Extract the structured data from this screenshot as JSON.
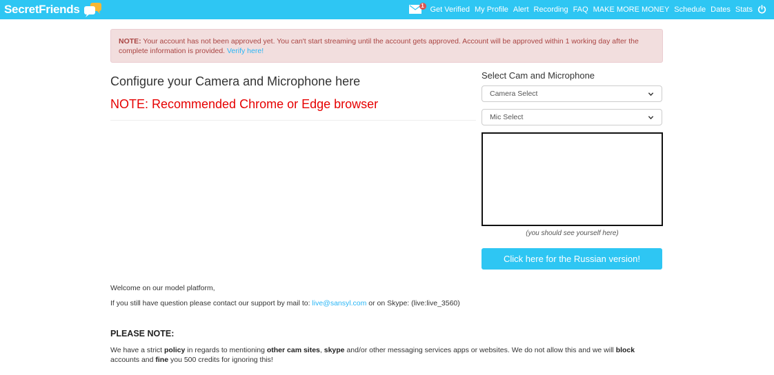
{
  "navbar": {
    "brand": "SecretFriends",
    "mail_count": "1",
    "items": [
      "Get Verified",
      "My Profile",
      "Alert",
      "Recording",
      "FAQ",
      "MAKE MORE MONEY",
      "Schedule",
      "Dates",
      "Stats"
    ],
    "colors": {
      "bar": "#2ec6f3",
      "badge": "#d9534f"
    }
  },
  "alert": {
    "label": "NOTE:",
    "text": " Your account has not been approved yet. You can't start streaming until the account gets approved. Account will be approved within 1 working day after the complete information is provided. ",
    "link": "Verify here!"
  },
  "main": {
    "title": "Configure your Camera and Microphone here",
    "browser_note": "NOTE: Recommended Chrome or Edge browser"
  },
  "device": {
    "heading": "Select Cam and Microphone",
    "camera_select": "Camera Select",
    "mic_select": "Mic Select",
    "preview_caption": "(you should see yourself here)",
    "russian_button": "Click here for the Russian version!"
  },
  "info": {
    "welcome": "Welcome on our model platform,",
    "contact_prefix": "If you still have question please contact our support by mail to: ",
    "contact_email": "live@sansyl.com",
    "contact_suffix": " or on Skype: (live:live_3560)",
    "please_note": "PLEASE NOTE:",
    "policy": {
      "p1": "We have a strict ",
      "b1": "policy",
      "p2": " in regards to mentioning ",
      "b2": "other cam sites",
      "p3": ", ",
      "b3": "skype",
      "p4": " and/or other messaging services apps or websites. We do not allow this and we will ",
      "b4": "block",
      "p5": " accounts and ",
      "b5": "fine",
      "p6": " you 500 credits for ignoring this!"
    }
  }
}
